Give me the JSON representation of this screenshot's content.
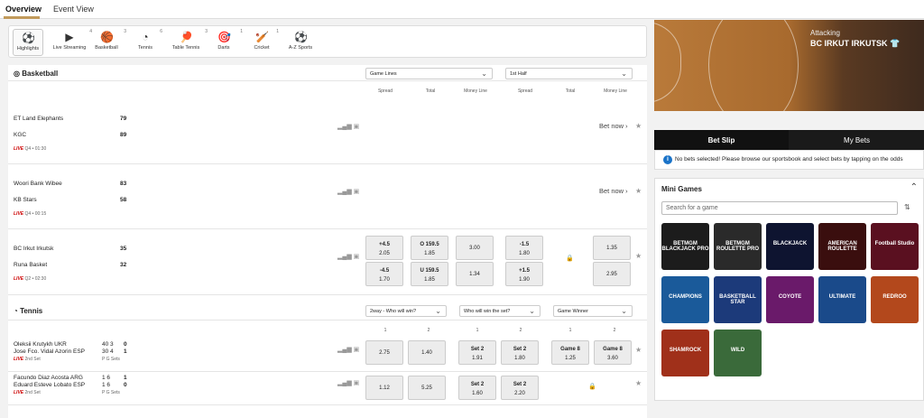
{
  "tabs": {
    "overview": "Overview",
    "event_view": "Event View"
  },
  "sports": [
    {
      "label": "Highlights",
      "icon": "highlights-icon",
      "glyph": "⚽",
      "count": ""
    },
    {
      "label": "Live Streaming",
      "icon": "live-streaming-icon",
      "glyph": "▶",
      "count": "4"
    },
    {
      "label": "Basketball",
      "icon": "basketball-icon",
      "glyph": "🏀",
      "count": "3"
    },
    {
      "label": "Tennis",
      "icon": "tennis-icon",
      "glyph": "◔",
      "count": "6"
    },
    {
      "label": "Table Tennis",
      "icon": "table-tennis-icon",
      "glyph": "🏓",
      "count": "3"
    },
    {
      "label": "Darts",
      "icon": "darts-icon",
      "glyph": "🎯",
      "count": "1"
    },
    {
      "label": "Cricket",
      "icon": "cricket-icon",
      "glyph": "🏏",
      "count": "1"
    },
    {
      "label": "A-Z Sports",
      "icon": "az-sports-icon",
      "glyph": "⚽",
      "count": ""
    }
  ],
  "basketball": {
    "title": "Basketball",
    "sel1": "Game Lines",
    "sel2": "1st Half",
    "cols": [
      "Spread",
      "Total",
      "Money Line",
      "Spread",
      "Total",
      "Money Line"
    ],
    "matches": [
      {
        "t1": "ET Land Elephants",
        "s1": "79",
        "t2": "KGC",
        "s2": "89",
        "live": "LIVE",
        "time": "Q4 • 01:30",
        "bet": "Bet now"
      },
      {
        "t1": "Woori Bank Wibee",
        "s1": "83",
        "t2": "KB Stars",
        "s2": "58",
        "live": "LIVE",
        "time": "Q4 • 00:15",
        "bet": "Bet now"
      },
      {
        "t1": "BC Irkut Irkutsk",
        "s1": "35",
        "t2": "Runa Basket",
        "s2": "32",
        "live": "LIVE",
        "time": "Q2 • 02:30",
        "odds": [
          [
            "+4.5",
            "2.05"
          ],
          [
            "O 159.5",
            "1.85"
          ],
          [
            "",
            "3.00"
          ],
          [
            "-1.5",
            "1.80"
          ],
          [
            "",
            "1.35"
          ],
          [
            "-4.5",
            "1.70"
          ],
          [
            "U 159.5",
            "1.85"
          ],
          [
            "",
            "1.34"
          ],
          [
            "+1.5",
            "1.90"
          ],
          [
            "",
            "2.95"
          ]
        ]
      }
    ]
  },
  "tennis": {
    "title": "Tennis",
    "sel1": "2way - Who will win?",
    "sel2": "Who will win the set?",
    "sel3": "Game Winner",
    "cols": [
      "1",
      "2",
      "1",
      "2",
      "1",
      "2"
    ],
    "matches": [
      {
        "p1": "Oleksii Krutykh",
        "c1": "UKR",
        "g1": "40",
        "set1": "3",
        "m1": "0",
        "p2": "Jose Fco. Vidal Azorin",
        "c2": "ESP",
        "g2": "30",
        "set2": "4",
        "m2": "1",
        "live": "LIVE",
        "stage": "2nd Set",
        "lab": "P   G   Sets",
        "odds": [
          [
            "",
            "2.75"
          ],
          [
            "",
            "1.40"
          ],
          [
            "Set 2",
            "1.91"
          ],
          [
            "Set 2",
            "1.80"
          ],
          [
            "Game 8",
            "1.25"
          ],
          [
            "Game 8",
            "3.60"
          ]
        ]
      },
      {
        "p1": "Facundo Diaz Acosta",
        "c1": "ARG",
        "g1": "1",
        "set1": "6",
        "m1": "1",
        "p2": "Eduard Esteve Lobato",
        "c2": "ESP",
        "g2": "1",
        "set2": "6",
        "m2": "0",
        "live": "LIVE",
        "stage": "2nd Set",
        "lab": "P   G   Sets",
        "odds": [
          [
            "",
            "1.12"
          ],
          [
            "",
            "5.25"
          ],
          [
            "Set 2",
            "1.60"
          ],
          [
            "Set 2",
            "2.20"
          ]
        ]
      }
    ]
  },
  "hero": {
    "attacking": "Attacking",
    "team": "BC IRKUT IRKUTSK"
  },
  "betslip": {
    "tab1": "Bet Slip",
    "tab2": "My Bets",
    "empty": "No bets selected! Please browse our sportsbook and select bets by tapping on the odds"
  },
  "mini_games": {
    "title": "Mini Games",
    "placeholder": "Search for a game",
    "games": [
      {
        "name": "BETMGM BLACKJACK PRO",
        "color": "#1c1c1c"
      },
      {
        "name": "BETMGM ROULETTE PRO",
        "color": "#2a2a2a"
      },
      {
        "name": "BLACKJACK",
        "color": "#0e1430"
      },
      {
        "name": "AMERICAN ROULETTE",
        "color": "#3a0e0e"
      },
      {
        "name": "Football Studio",
        "color": "#5a1020"
      },
      {
        "name": "CHAMPIONS",
        "color": "#1a5a9a"
      },
      {
        "name": "BASKETBALL STAR",
        "color": "#1c3a7a"
      },
      {
        "name": "COYOTE",
        "color": "#6a1a6a"
      },
      {
        "name": "ULTIMATE",
        "color": "#1a4a8a"
      },
      {
        "name": "REDROO",
        "color": "#b3481c"
      },
      {
        "name": "SHAMROCK",
        "color": "#a0301a"
      },
      {
        "name": "WILD",
        "color": "#3a6a3a"
      }
    ]
  }
}
